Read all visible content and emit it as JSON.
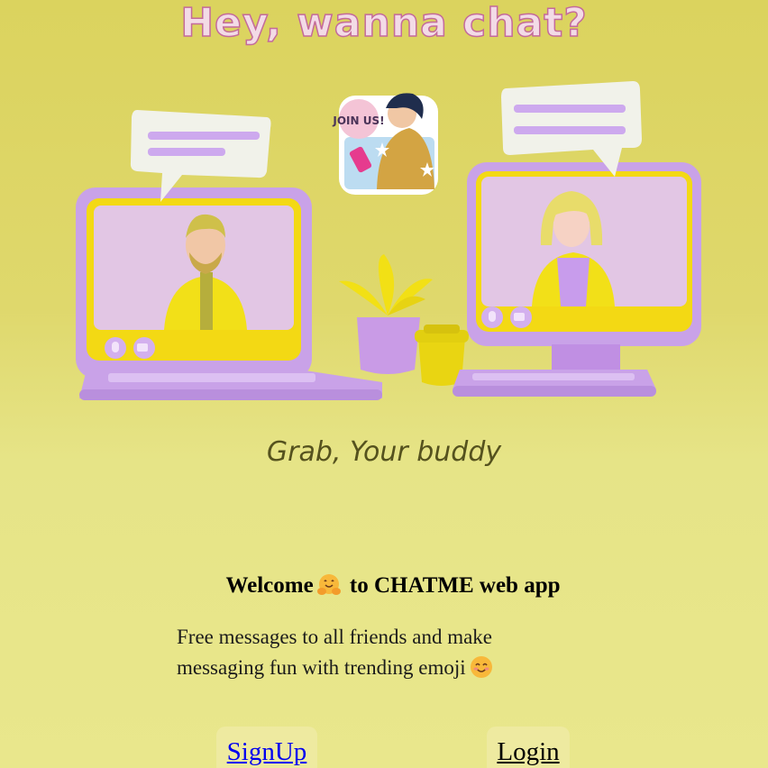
{
  "header": {
    "title": "Hey, wanna chat?"
  },
  "hero": {
    "sticker_text": "JOIN US!"
  },
  "tagline": "Grab, Your buddy",
  "welcome": {
    "before": "Welcome",
    "after": "to CHATME web app",
    "emoji": "hugging-face-icon"
  },
  "description": {
    "line1": "Free messages to all friends and make",
    "line2": "messaging fun with trending emoji",
    "emoji": "smiling-face-icon"
  },
  "actions": {
    "signup_label": "SignUp",
    "login_label": "Login"
  },
  "colors": {
    "background": "#dfd86c",
    "title_fill": "#f3dbe6",
    "title_stroke": "#c46a9a",
    "accent_purple": "#cfa6ec",
    "accent_yellow": "#f2dc10",
    "button_bg": "#eeeaa0",
    "link": "#0000ee"
  }
}
